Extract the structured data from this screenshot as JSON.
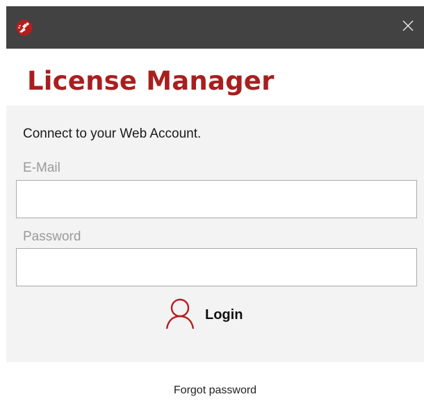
{
  "window": {
    "icon": "app-logo-icon",
    "close_icon": "close-icon",
    "title_bar_color": "#424242"
  },
  "header": {
    "title": "License Manager",
    "title_color": "#a81f1f"
  },
  "form": {
    "intro": "Connect to your Web Account.",
    "email_label": "E-Mail",
    "email_value": "",
    "password_label": "Password",
    "password_value": "",
    "login_icon": "user-icon",
    "login_label": "Login"
  },
  "footer": {
    "forgot_label": "Forgot password"
  }
}
